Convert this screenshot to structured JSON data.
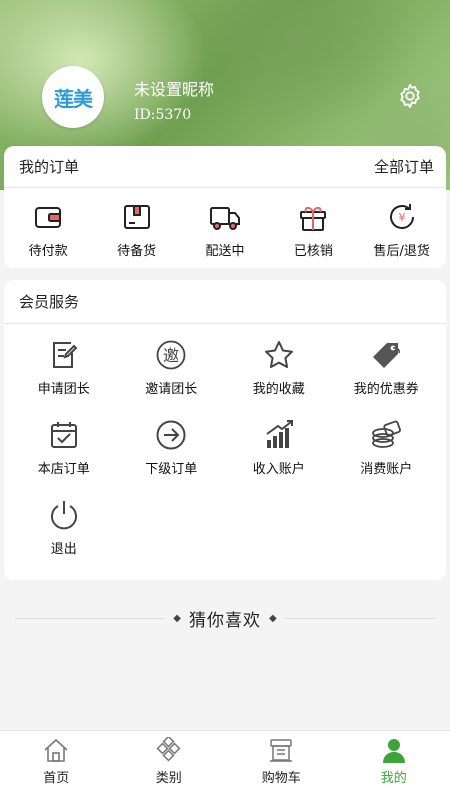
{
  "header": {
    "avatar_logo_text": "莲美",
    "nickname": "未设置昵称",
    "user_id": "ID:5370",
    "settings_icon": "gear-icon"
  },
  "orders": {
    "title": "我的订单",
    "all_link": "全部订单",
    "items": [
      {
        "label": "待付款",
        "icon": "wallet-icon"
      },
      {
        "label": "待备货",
        "icon": "package-icon"
      },
      {
        "label": "配送中",
        "icon": "truck-icon"
      },
      {
        "label": "已核销",
        "icon": "gift-icon"
      },
      {
        "label": "售后/退货",
        "icon": "refund-icon"
      }
    ]
  },
  "services": {
    "title": "会员服务",
    "items": [
      {
        "label": "申请团长",
        "icon": "edit-doc-icon"
      },
      {
        "label": "邀请团长",
        "icon": "invite-icon",
        "icon_text": "邀"
      },
      {
        "label": "我的收藏",
        "icon": "star-icon"
      },
      {
        "label": "我的优惠券",
        "icon": "coupon-tag-icon"
      },
      {
        "label": "本店订单",
        "icon": "calendar-check-icon"
      },
      {
        "label": "下级订单",
        "icon": "arrow-circle-icon"
      },
      {
        "label": "收入账户",
        "icon": "bar-chart-icon"
      },
      {
        "label": "消费账户",
        "icon": "coins-icon"
      },
      {
        "label": "退出",
        "icon": "power-icon"
      }
    ]
  },
  "guess": {
    "title": "猜你喜欢"
  },
  "tabbar": {
    "items": [
      {
        "label": "首页",
        "icon": "home-icon",
        "active": false
      },
      {
        "label": "类别",
        "icon": "category-icon",
        "active": false
      },
      {
        "label": "购物车",
        "icon": "cart-icon",
        "active": false
      },
      {
        "label": "我的",
        "icon": "user-icon",
        "active": true
      }
    ],
    "active_color": "#3ea33a"
  }
}
